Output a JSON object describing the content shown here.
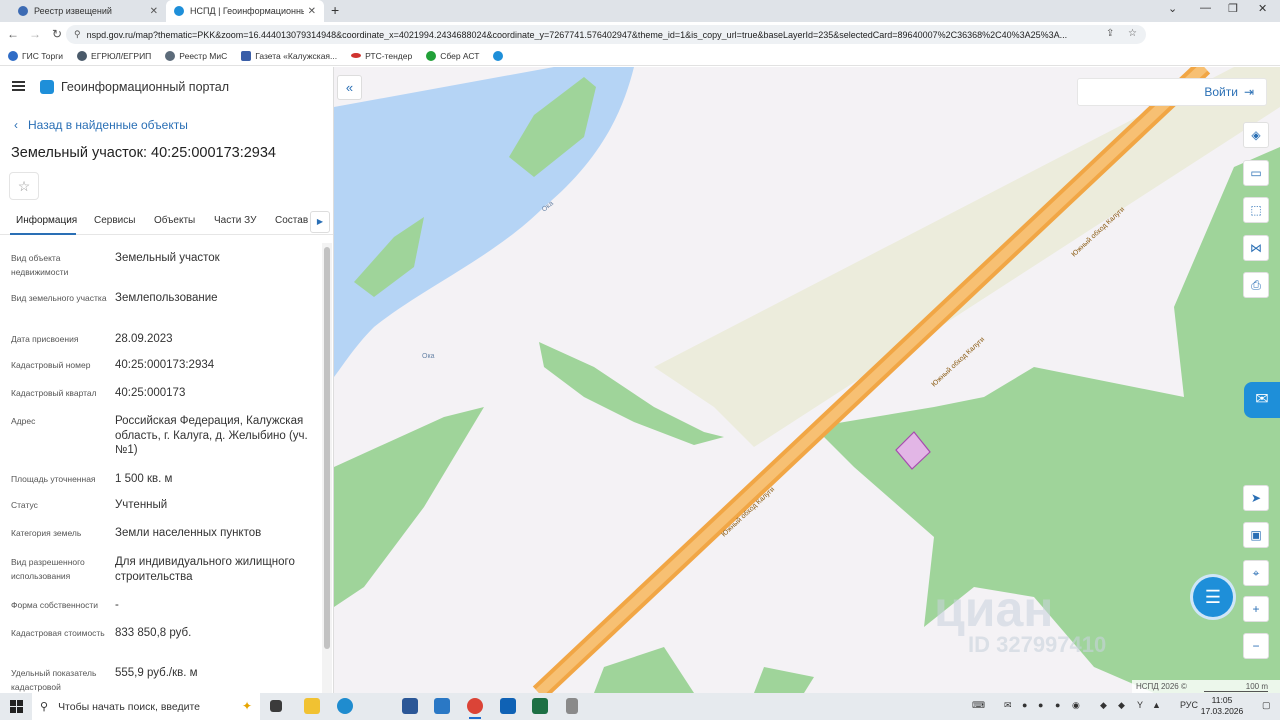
{
  "browser": {
    "tabs": [
      {
        "label": "Реестр извещений",
        "active": false
      },
      {
        "label": "НСПД | Геоинформационный п",
        "active": true
      }
    ],
    "new_tab": "+",
    "url": "nspd.gov.ru/map?thematic=PKK&zoom=16.444013079314948&coordinate_x=4021994.2434688024&coordinate_y=7267741.576402947&theme_id=1&is_copy_url=true&baseLayerId=235&selectedCard=89640007%2C36368%2C40%3A25%3A...",
    "bookmarks": [
      {
        "label": "ГИС Торги",
        "color": "#2f6cc6"
      },
      {
        "label": "ЕГРЮЛ/ЕГРИП",
        "color": "#4a5a6a"
      },
      {
        "label": "Реестр МиС",
        "color": "#5c6b7a"
      },
      {
        "label": "Газета «Калужская...",
        "color": "#3a5ea8"
      },
      {
        "label": "РТС-тендер",
        "color": "#d0332f"
      },
      {
        "label": "Сбер АСТ",
        "color": "#21a038"
      },
      {
        "label": "",
        "color": "#1e8fd9"
      }
    ]
  },
  "portal": {
    "title": "Геоинформационный портал",
    "back_link": "Назад в найденные объекты",
    "object_title": "Земельный участок: 40:25:000173:2934",
    "tabs": [
      "Информация",
      "Сервисы",
      "Объекты",
      "Части ЗУ",
      "Состав"
    ],
    "active_tab": "Информация",
    "properties": [
      {
        "label": "Вид объекта недвижимости",
        "value": "Земельный участок"
      },
      {
        "label": "Вид земельного участка",
        "value": "Землепользование"
      },
      {
        "label": "Дата присвоения",
        "value": "28.09.2023"
      },
      {
        "label": "Кадастровый номер",
        "value": "40:25:000173:2934"
      },
      {
        "label": "Кадастровый квартал",
        "value": "40:25:000173"
      },
      {
        "label": "Адрес",
        "value": "Российская Федерация, Калужская область, г. Калуга, д. Желыбино (уч. №1)"
      },
      {
        "label": "Площадь уточненная",
        "value": "1 500 кв. м"
      },
      {
        "label": "Статус",
        "value": "Учтенный"
      },
      {
        "label": "Категория земель",
        "value": "Земли населенных пунктов"
      },
      {
        "label": "Вид разрешенного использования",
        "value": "Для индивидуального жилищного строительства"
      },
      {
        "label": "Форма собственности",
        "value": "-"
      },
      {
        "label": "Кадастровая стоимость",
        "value": "833 850,8 руб."
      },
      {
        "label": "Удельный показатель кадастровой",
        "value": "555,9 руб./кв. м"
      }
    ]
  },
  "map": {
    "login": "Войти",
    "road_label": "Южный обход Калуги",
    "river_label": "Ока",
    "copyright": "НСПД 2026 ©",
    "scale": "100 m",
    "watermark": "циан",
    "watermark_id": "ID 327997410"
  },
  "taskbar": {
    "search_placeholder": "Чтобы начать поиск, введите",
    "lang": "РУС",
    "time": "11:05",
    "date": "17.03.2026"
  }
}
